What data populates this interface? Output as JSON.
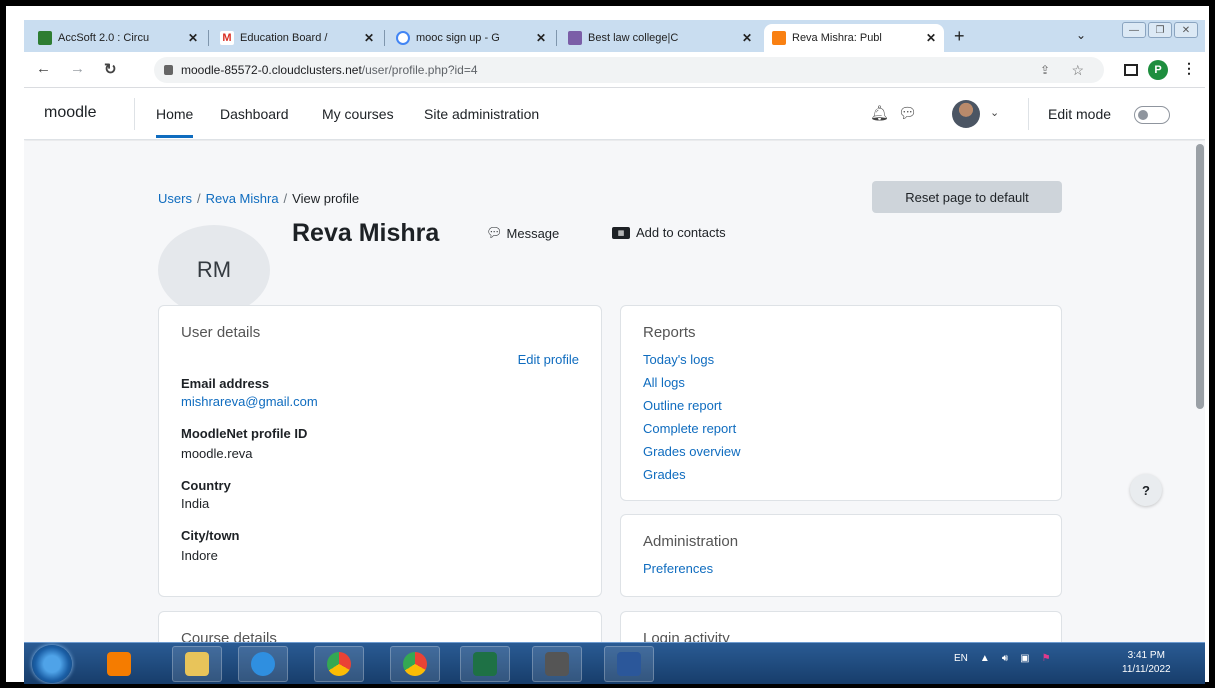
{
  "browser": {
    "tabs": [
      {
        "title": "AccSoft 2.0 : Circu",
        "color": "#2e7d32"
      },
      {
        "title": "Education Board /",
        "color": "#d93025"
      },
      {
        "title": "mooc sign up - G",
        "color": "#4285f4"
      },
      {
        "title": "Best law college|C",
        "color": "#7b5ea7"
      },
      {
        "title": "Reva Mishra: Publ",
        "color": "#f98012"
      }
    ],
    "new_tab": "+",
    "url_host": "moodle-85572-0.cloudclusters.net",
    "url_path": "/user/profile.php?id=4",
    "profile_initial": "P"
  },
  "navbar": {
    "brand": "moodle",
    "links": [
      "Home",
      "Dashboard",
      "My courses",
      "Site administration"
    ],
    "edit_mode": "Edit mode"
  },
  "breadcrumb": {
    "items": [
      "Users",
      "Reva Mishra",
      "View profile"
    ]
  },
  "reset_button": "Reset page to default",
  "profile": {
    "initials": "RM",
    "name": "Reva Mishra",
    "message": "Message",
    "add_contacts": "Add to contacts"
  },
  "user_details": {
    "title": "User details",
    "edit_profile": "Edit profile",
    "fields": [
      {
        "label": "Email address",
        "value": "mishrareva@gmail.com"
      },
      {
        "label": "MoodleNet profile ID",
        "value": "moodle.reva"
      },
      {
        "label": "Country",
        "value": "India"
      },
      {
        "label": "City/town",
        "value": "Indore"
      }
    ]
  },
  "reports": {
    "title": "Reports",
    "links": [
      "Today's logs",
      "All logs",
      "Outline report",
      "Complete report",
      "Grades overview",
      "Grades"
    ]
  },
  "administration": {
    "title": "Administration",
    "links": [
      "Preferences"
    ]
  },
  "course_details": {
    "title": "Course details"
  },
  "login_activity": {
    "title": "Login activity"
  },
  "help": "?",
  "taskbar": {
    "lang": "EN",
    "time": "3:41 PM",
    "date": "11/11/2022"
  }
}
